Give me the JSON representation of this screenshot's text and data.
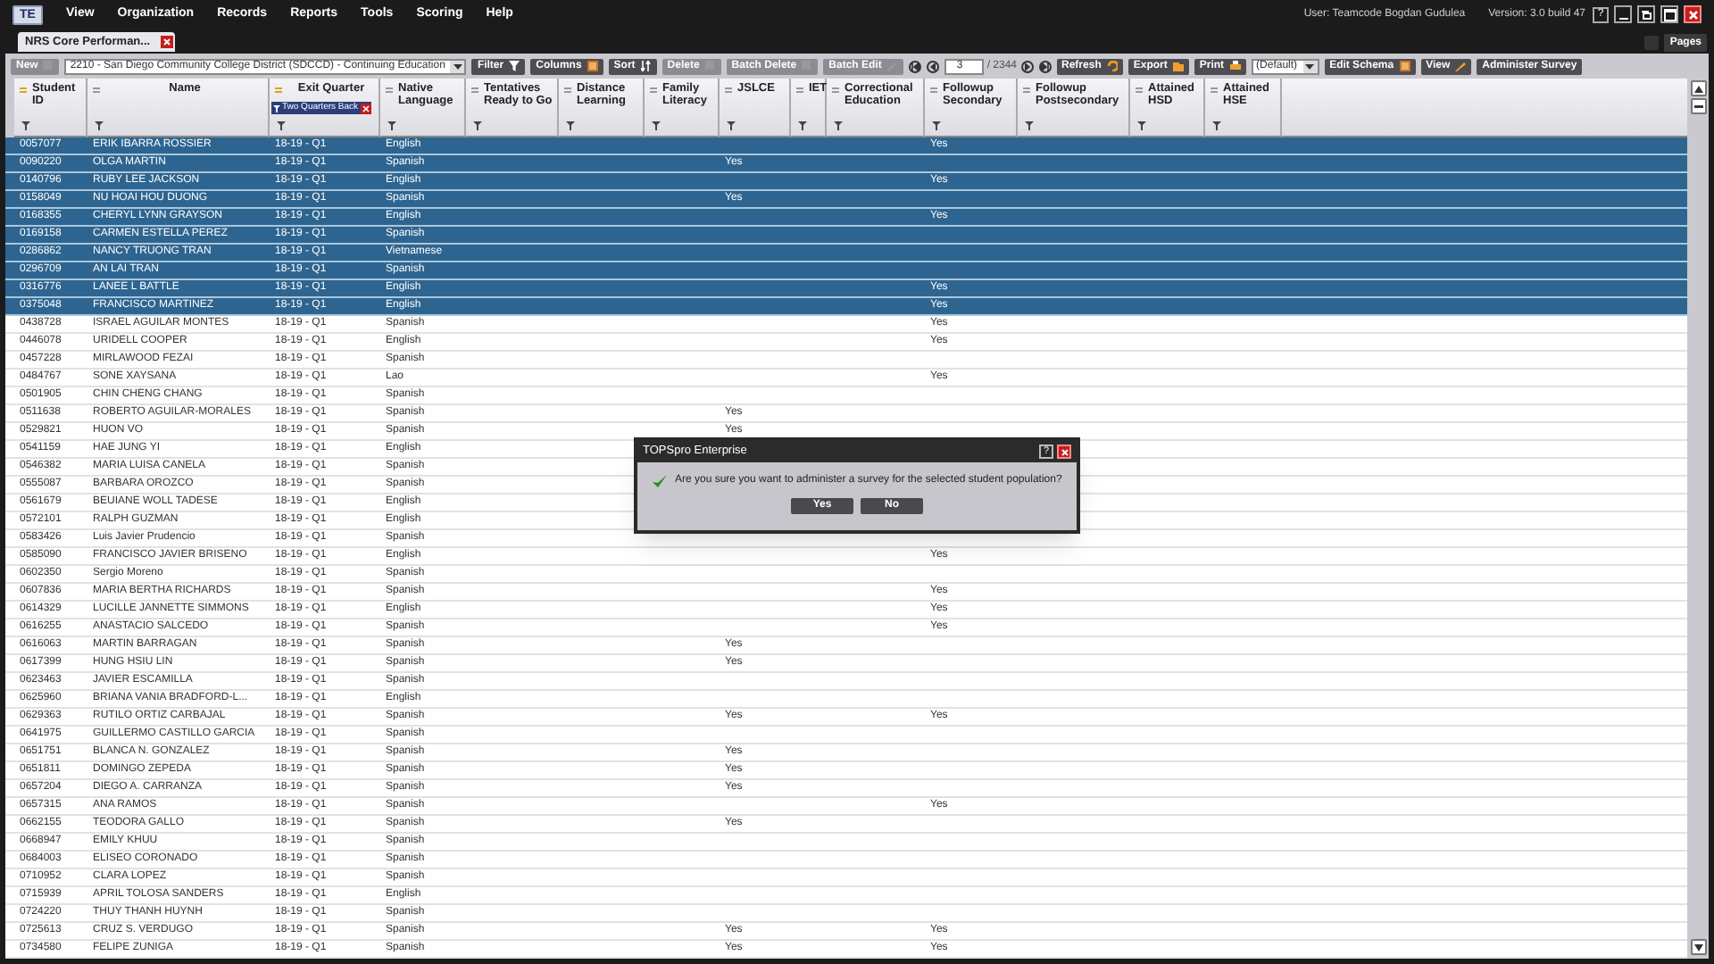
{
  "menu": {
    "logo": "TE",
    "items": [
      "View",
      "Organization",
      "Records",
      "Reports",
      "Tools",
      "Scoring",
      "Help"
    ]
  },
  "user_info": "User: Teamcode Bogdan Gudulea",
  "version": "Version: 3.0 build 47",
  "window_buttons": [
    "?"
  ],
  "tab": {
    "label": "NRS Core Performan...",
    "selected": true
  },
  "pages_button": "Pages",
  "toolbar": [
    {
      "kind": "button",
      "label": "New",
      "disabled": true
    },
    {
      "kind": "dropdown",
      "value": "2210 - San Diego Community College District (SDCCD) - Continuing Education"
    },
    {
      "kind": "button",
      "label": "Filter",
      "disabled": false
    },
    {
      "kind": "button",
      "label": "Columns",
      "disabled": false
    },
    {
      "kind": "button",
      "label": "Sort",
      "disabled": false
    },
    {
      "kind": "button",
      "label": "Delete",
      "disabled": true
    },
    {
      "kind": "button",
      "label": "Batch Delete",
      "disabled": true
    },
    {
      "kind": "button",
      "label": "Batch Edit",
      "disabled": true
    },
    {
      "kind": "pager",
      "page": "3",
      "total": "/ 2344"
    },
    {
      "kind": "button",
      "label": "Refresh",
      "disabled": false
    },
    {
      "kind": "button",
      "label": "Export",
      "disabled": false
    },
    {
      "kind": "button",
      "label": "Print",
      "disabled": false
    },
    {
      "kind": "dropdown",
      "value": "(Default)"
    },
    {
      "kind": "button",
      "label": "Edit Schema",
      "disabled": false
    },
    {
      "kind": "button",
      "label": "View",
      "disabled": false
    },
    {
      "kind": "button",
      "label": "Administer Survey",
      "disabled": false
    }
  ],
  "columns": [
    {
      "label": "Student ID",
      "sorted": true
    },
    {
      "label": "Name",
      "sorted": false
    },
    {
      "label": "Exit Quarter",
      "sorted": true,
      "filter_chip": "Two Quarters Back"
    },
    {
      "label": "Native Language",
      "sorted": false
    },
    {
      "label": "Tentatives Ready to Go",
      "sorted": false
    },
    {
      "label": "Distance Learning",
      "sorted": false
    },
    {
      "label": "Family Literacy",
      "sorted": false
    },
    {
      "label": "JSLCE",
      "sorted": false
    },
    {
      "label": "IET",
      "sorted": false
    },
    {
      "label": "Correctional Education",
      "sorted": false
    },
    {
      "label": "Followup Secondary",
      "sorted": false
    },
    {
      "label": "Followup Postsecondary",
      "sorted": false
    },
    {
      "label": "Attained HSD",
      "sorted": false
    },
    {
      "label": "Attained HSE",
      "sorted": false
    }
  ],
  "rows": [
    {
      "selected": true,
      "cells": [
        "0057077",
        "ERIK IBARRA ROSSIER",
        "18-19 - Q1",
        "English",
        null,
        null,
        null,
        null,
        null,
        null,
        "Yes"
      ]
    },
    {
      "selected": true,
      "cells": [
        "0090220",
        "OLGA MARTIN",
        "18-19 - Q1",
        "Spanish",
        null,
        null,
        null,
        "Yes"
      ]
    },
    {
      "selected": true,
      "cells": [
        "0140796",
        "RUBY LEE JACKSON",
        "18-19 - Q1",
        "English",
        null,
        null,
        null,
        null,
        null,
        null,
        "Yes"
      ]
    },
    {
      "selected": true,
      "cells": [
        "0158049",
        "NU HOAI HOU DUONG",
        "18-19 - Q1",
        "Spanish",
        null,
        null,
        null,
        "Yes"
      ]
    },
    {
      "selected": true,
      "cells": [
        "0168355",
        "CHERYL LYNN GRAYSON",
        "18-19 - Q1",
        "English",
        null,
        null,
        null,
        null,
        null,
        null,
        "Yes"
      ]
    },
    {
      "selected": true,
      "cells": [
        "0169158",
        "CARMEN ESTELLA PEREZ",
        "18-19 - Q1",
        "Spanish"
      ]
    },
    {
      "selected": true,
      "cells": [
        "0286862",
        "NANCY TRUONG TRAN",
        "18-19 - Q1",
        "Vietnamese"
      ]
    },
    {
      "selected": true,
      "cells": [
        "0296709",
        "AN LAI TRAN",
        "18-19 - Q1",
        "Spanish"
      ]
    },
    {
      "selected": true,
      "cells": [
        "0316776",
        "LANEE L BATTLE",
        "18-19 - Q1",
        "English",
        null,
        null,
        null,
        null,
        null,
        null,
        "Yes"
      ]
    },
    {
      "selected": true,
      "cells": [
        "0375048",
        "FRANCISCO MARTINEZ",
        "18-19 - Q1",
        "English",
        null,
        null,
        null,
        null,
        null,
        null,
        "Yes"
      ]
    },
    {
      "selected": false,
      "cells": [
        "0438728",
        "ISRAEL AGUILAR MONTES",
        "18-19 - Q1",
        "Spanish",
        null,
        null,
        null,
        null,
        null,
        null,
        "Yes"
      ]
    },
    {
      "selected": false,
      "cells": [
        "0446078",
        "URIDELL COOPER",
        "18-19 - Q1",
        "English",
        null,
        null,
        null,
        null,
        null,
        null,
        "Yes"
      ]
    },
    {
      "selected": false,
      "cells": [
        "0457228",
        "MIRLAWOOD FEZAI",
        "18-19 - Q1",
        "Spanish"
      ]
    },
    {
      "selected": false,
      "cells": [
        "0484767",
        "SONE XAYSANA",
        "18-19 - Q1",
        "Lao",
        null,
        null,
        null,
        null,
        null,
        null,
        "Yes"
      ]
    },
    {
      "selected": false,
      "cells": [
        "0501905",
        "CHIN CHENG CHANG",
        "18-19 - Q1",
        "Spanish"
      ]
    },
    {
      "selected": false,
      "cells": [
        "0511638",
        "ROBERTO AGUILAR-MORALES",
        "18-19 - Q1",
        "Spanish",
        null,
        null,
        null,
        "Yes"
      ]
    },
    {
      "selected": false,
      "cells": [
        "0529821",
        "HUON VO",
        "18-19 - Q1",
        "Spanish",
        null,
        null,
        null,
        "Yes"
      ]
    },
    {
      "selected": false,
      "cells": [
        "0541159",
        "HAE JUNG YI",
        "18-19 - Q1",
        "English"
      ]
    },
    {
      "selected": false,
      "cells": [
        "0546382",
        "MARIA LUISA CANELA",
        "18-19 - Q1",
        "Spanish"
      ]
    },
    {
      "selected": false,
      "cells": [
        "0555087",
        "BARBARA OROZCO",
        "18-19 - Q1",
        "Spanish"
      ]
    },
    {
      "selected": false,
      "cells": [
        "0561679",
        "BEUIANE WOLL TADESE",
        "18-19 - Q1",
        "English"
      ]
    },
    {
      "selected": false,
      "cells": [
        "0572101",
        "RALPH GUZMAN",
        "18-19 - Q1",
        "English"
      ]
    },
    {
      "selected": false,
      "cells": [
        "0583426",
        "Luis Javier Prudencio",
        "18-19 - Q1",
        "Spanish"
      ]
    },
    {
      "selected": false,
      "cells": [
        "0585090",
        "FRANCISCO JAVIER BRISENO",
        "18-19 - Q1",
        "English",
        null,
        null,
        null,
        null,
        null,
        null,
        "Yes"
      ]
    },
    {
      "selected": false,
      "cells": [
        "0602350",
        "Sergio Moreno",
        "18-19 - Q1",
        "Spanish"
      ]
    },
    {
      "selected": false,
      "cells": [
        "0607836",
        "MARIA BERTHA RICHARDS",
        "18-19 - Q1",
        "Spanish",
        null,
        null,
        null,
        null,
        null,
        null,
        "Yes"
      ]
    },
    {
      "selected": false,
      "cells": [
        "0614329",
        "LUCILLE JANNETTE SIMMONS",
        "18-19 - Q1",
        "English",
        null,
        null,
        null,
        null,
        null,
        null,
        "Yes"
      ]
    },
    {
      "selected": false,
      "cells": [
        "0616255",
        "ANASTACIO SALCEDO",
        "18-19 - Q1",
        "Spanish",
        null,
        null,
        null,
        null,
        null,
        null,
        "Yes"
      ]
    },
    {
      "selected": false,
      "cells": [
        "0616063",
        "MARTIN BARRAGAN",
        "18-19 - Q1",
        "Spanish",
        null,
        null,
        null,
        "Yes"
      ]
    },
    {
      "selected": false,
      "cells": [
        "0617399",
        "HUNG HSIU LIN",
        "18-19 - Q1",
        "Spanish",
        null,
        null,
        null,
        "Yes"
      ]
    },
    {
      "selected": false,
      "cells": [
        "0623463",
        "JAVIER ESCAMILLA",
        "18-19 - Q1",
        "Spanish"
      ]
    },
    {
      "selected": false,
      "cells": [
        "0625960",
        "BRIANA VANIA BRADFORD-L...",
        "18-19 - Q1",
        "English"
      ]
    },
    {
      "selected": false,
      "cells": [
        "0629363",
        "RUTILO ORTIZ CARBAJAL",
        "18-19 - Q1",
        "Spanish",
        null,
        null,
        null,
        "Yes",
        null,
        null,
        "Yes"
      ]
    },
    {
      "selected": false,
      "cells": [
        "0641975",
        "GUILLERMO CASTILLO GARCIA",
        "18-19 - Q1",
        "Spanish"
      ]
    },
    {
      "selected": false,
      "cells": [
        "0651751",
        "BLANCA N. GONZALEZ",
        "18-19 - Q1",
        "Spanish",
        null,
        null,
        null,
        "Yes"
      ]
    },
    {
      "selected": false,
      "cells": [
        "0651811",
        "DOMINGO ZEPEDA",
        "18-19 - Q1",
        "Spanish",
        null,
        null,
        null,
        "Yes"
      ]
    },
    {
      "selected": false,
      "cells": [
        "0657204",
        "DIEGO A. CARRANZA",
        "18-19 - Q1",
        "Spanish",
        null,
        null,
        null,
        "Yes"
      ]
    },
    {
      "selected": false,
      "cells": [
        "0657315",
        "ANA RAMOS",
        "18-19 - Q1",
        "Spanish",
        null,
        null,
        null,
        null,
        null,
        null,
        "Yes"
      ]
    },
    {
      "selected": false,
      "cells": [
        "0662155",
        "TEODORA GALLO",
        "18-19 - Q1",
        "Spanish",
        null,
        null,
        null,
        "Yes"
      ]
    },
    {
      "selected": false,
      "cells": [
        "0668947",
        "EMILY KHUU",
        "18-19 - Q1",
        "Spanish"
      ]
    },
    {
      "selected": false,
      "cells": [
        "0684003",
        "ELISEO CORONADO",
        "18-19 - Q1",
        "Spanish"
      ]
    },
    {
      "selected": false,
      "cells": [
        "0710952",
        "CLARA LOPEZ",
        "18-19 - Q1",
        "Spanish"
      ]
    },
    {
      "selected": false,
      "cells": [
        "0715939",
        "APRIL TOLOSA SANDERS",
        "18-19 - Q1",
        "English"
      ]
    },
    {
      "selected": false,
      "cells": [
        "0724220",
        "THUY THANH HUYNH",
        "18-19 - Q1",
        "Spanish"
      ]
    },
    {
      "selected": false,
      "cells": [
        "0725613",
        "CRUZ S. VERDUGO",
        "18-19 - Q1",
        "Spanish",
        null,
        null,
        null,
        "Yes",
        null,
        null,
        "Yes"
      ]
    },
    {
      "selected": false,
      "cells": [
        "0734580",
        "FELIPE ZUNIGA",
        "18-19 - Q1",
        "Spanish",
        null,
        null,
        null,
        "Yes",
        null,
        null,
        "Yes"
      ]
    }
  ],
  "dialog": {
    "title": "TOPSpro Enterprise",
    "help": "?",
    "message": "Are you sure you want to administer a survey for the selected student population?",
    "buttons": [
      "Yes",
      "No"
    ]
  }
}
